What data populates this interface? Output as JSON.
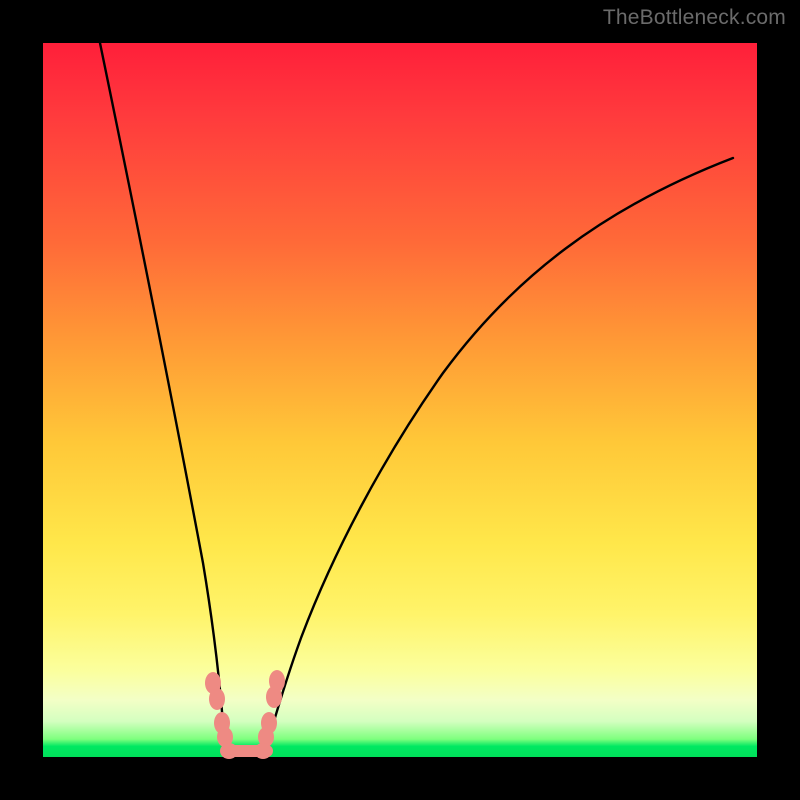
{
  "watermark": "TheBottleneck.com",
  "chart_data": {
    "type": "line",
    "title": "",
    "xlabel": "",
    "ylabel": "",
    "xlim": [
      0,
      100
    ],
    "ylim": [
      0,
      100
    ],
    "series": [
      {
        "name": "left-curve",
        "x": [
          8,
          10,
          12,
          14,
          16,
          18,
          20,
          22,
          23.5,
          24.5,
          25
        ],
        "y": [
          100,
          89,
          78,
          66,
          55,
          43,
          31,
          18,
          10,
          5,
          2
        ]
      },
      {
        "name": "right-curve",
        "x": [
          31,
          33,
          36,
          40,
          45,
          52,
          60,
          70,
          82,
          96
        ],
        "y": [
          2,
          8,
          17,
          28,
          40,
          52,
          62,
          71,
          78,
          84
        ]
      }
    ],
    "annotations": [
      {
        "name": "left-marker-upper",
        "x": 23.5,
        "y": 10
      },
      {
        "name": "left-marker-lower",
        "x": 24.5,
        "y": 4
      },
      {
        "name": "right-marker-upper",
        "x": 32.5,
        "y": 10
      },
      {
        "name": "right-marker-lower",
        "x": 31.5,
        "y": 4
      },
      {
        "name": "bottom-marker-a",
        "x": 26,
        "y": 1
      },
      {
        "name": "bottom-marker-b",
        "x": 29,
        "y": 1
      }
    ],
    "background_gradient": {
      "top": "#ff1f3a",
      "mid": "#ffe74a",
      "bottom": "#00e05a"
    }
  }
}
